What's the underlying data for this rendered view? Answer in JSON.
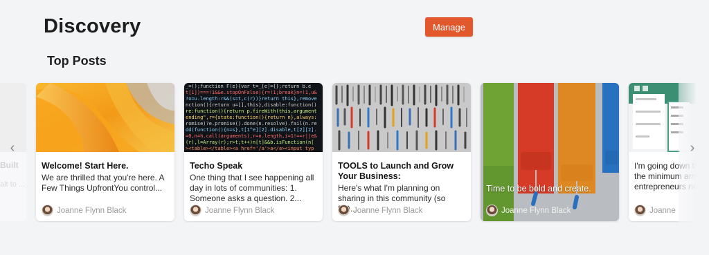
{
  "header": {
    "title": "Discovery",
    "manage_label": "Manage"
  },
  "section": {
    "title": "Top Posts"
  },
  "carousel": {
    "ghost_prev": {
      "title": "Built",
      "text": "alt to ..."
    },
    "cards": [
      {
        "title": "Welcome! Start Here.",
        "text": "We are thrilled that you're here. A Few Things UpfrontYou control...",
        "author": "Joanne Flynn Black",
        "image": "orange-abstract"
      },
      {
        "title": "Techo Speak",
        "text": "One thing that I see happening all day in lots of communities: 1. Someone asks a question. 2...",
        "author": "Joanne Flynn Black",
        "image": "code-screen"
      },
      {
        "title": "TOOLS to Launch and Grow Your Business:",
        "text": "Here's what I'm planning on sharing in this community (so far)...",
        "author": "Joanne Flynn Black",
        "image": "tools-flatlay"
      },
      {
        "title": "",
        "text": "Time to be bold and create.",
        "author": "Joanne Flynn Black",
        "image": "paint-rollers"
      },
      {
        "title": "",
        "text": "I'm going down this path what would the minimum amount of products entrepreneurs need",
        "author": "Joanne",
        "image": "app-screenshot"
      }
    ],
    "prev_arrow": "‹",
    "next_arrow": "›"
  },
  "colors": {
    "accent": "#e0582b",
    "background": "#f3f4f6"
  }
}
